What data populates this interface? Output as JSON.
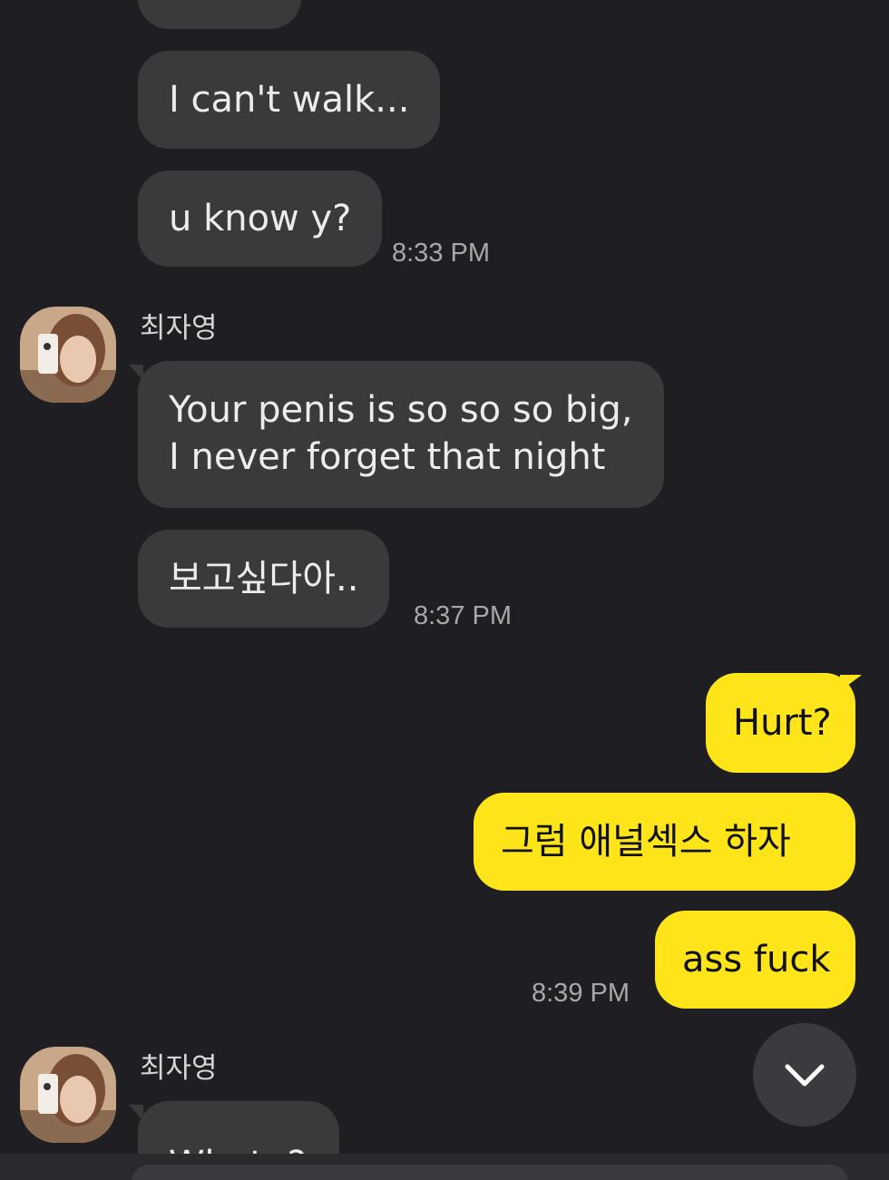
{
  "messages": {
    "m0": "",
    "m1": "I can't walk...",
    "m2": "u know y?",
    "t1": "8:33 PM",
    "sender1": "최자영",
    "m3_line1": "Your penis is so so so big,",
    "m3_line2": "I never forget that night",
    "m4": "보고싶다아..",
    "t2": "8:37 PM",
    "m5": "Hurt?",
    "m6": "그럼  애널섹스 하자",
    "m7": "ass fuck",
    "t3": "8:39 PM",
    "sender2": "최자영",
    "m8": "What..?"
  },
  "icons": {
    "scroll_down": "chevron-down-icon",
    "avatar": "avatar"
  },
  "colors": {
    "background": "#1f1f23",
    "incoming_bubble": "#3a3a3d",
    "outgoing_bubble": "#fde51a"
  }
}
